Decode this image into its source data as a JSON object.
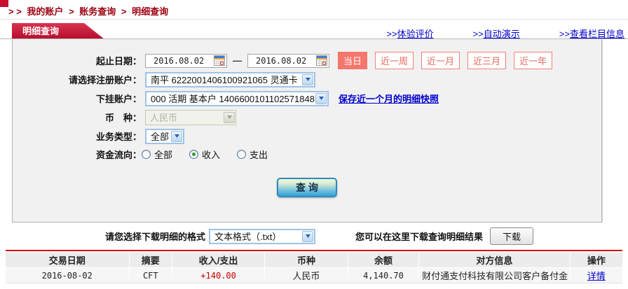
{
  "breadcrumb": {
    "prefix": "> >",
    "separator": ">",
    "items": [
      {
        "label": "我的账户"
      },
      {
        "label": "账务查询"
      },
      {
        "label": "明细查询"
      }
    ]
  },
  "tab": {
    "label": "明细查询"
  },
  "header_links": [
    {
      "prefix": ">>",
      "label": "体验评价"
    },
    {
      "prefix": ">>",
      "label": "自动演示"
    },
    {
      "prefix": ">>",
      "label": "查看栏目信息"
    }
  ],
  "form": {
    "date_range": {
      "label": "起止日期：",
      "start": "2016.08.02",
      "end": "2016.08.02",
      "separator": "—"
    },
    "quick_buttons": [
      {
        "label": "当日",
        "active": true
      },
      {
        "label": "近一周",
        "active": false
      },
      {
        "label": "近一月",
        "active": false
      },
      {
        "label": "近三月",
        "active": false
      },
      {
        "label": "近一年",
        "active": false
      }
    ],
    "registered_account": {
      "label": "请选择注册账户：",
      "value": "南平 6222001406100921065 灵通卡"
    },
    "sub_account": {
      "label": "下挂账户：",
      "value": "000 活期 基本户 1406600101102571848",
      "link": "保存近一个月的明细快照"
    },
    "currency": {
      "label": "币　种：",
      "value": "人民币",
      "disabled": true
    },
    "business_type": {
      "label": "业务类型：",
      "value": "全部"
    },
    "fund_flow": {
      "label": "资金流向：",
      "options": [
        {
          "label": "全部",
          "checked": false
        },
        {
          "label": "收入",
          "checked": true
        },
        {
          "label": "支出",
          "checked": false
        }
      ]
    },
    "submit_label": "查 询"
  },
  "download": {
    "format_label": "请您选择下载明细的格式",
    "format_value": "文本格式（.txt）",
    "hint": "您可以在这里下载查询明细结果",
    "button_label": "下载"
  },
  "table": {
    "headers": [
      "交易日期",
      "摘要",
      "收入/支出",
      "币种",
      "余额",
      "对方信息",
      "操作"
    ],
    "rows": [
      [
        "2016-08-02",
        "CFT",
        "+140.00",
        "人民币",
        "4,140.70",
        "财付通支付科技有限公司客户备付金",
        "详情"
      ]
    ]
  },
  "colors": {
    "accent_red": "#c8102e",
    "salmon": "#f5766d",
    "link_blue": "#0000cc",
    "amount_red": "#cc0000",
    "query_button_blue": "#33a1d4"
  }
}
